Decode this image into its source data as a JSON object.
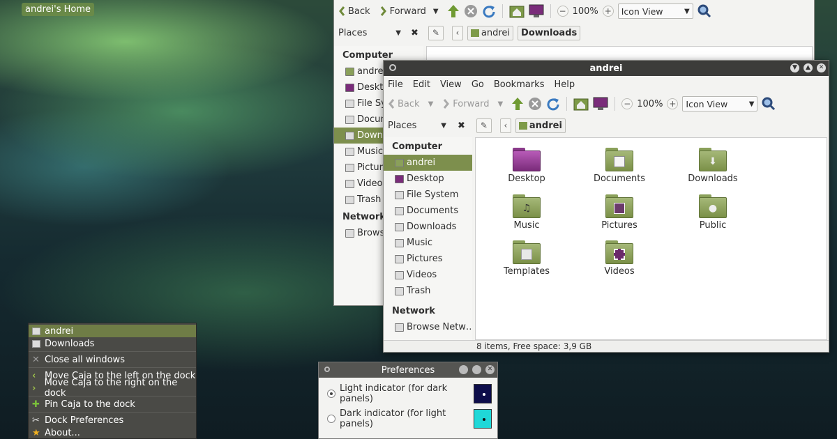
{
  "desktop": {
    "home_label": "andrei's Home"
  },
  "back_window": {
    "toolbar": {
      "back": "Back",
      "forward": "Forward",
      "zoom": "100%",
      "view_mode": "Icon View"
    },
    "location": {
      "places": "Places",
      "crumbs": [
        "andrei",
        "Downloads"
      ]
    },
    "sidebar": {
      "computer_heading": "Computer",
      "items": [
        "andrei",
        "Desktop",
        "File System",
        "Documents",
        "Downloads",
        "Music",
        "Pictures",
        "Videos",
        "Trash"
      ],
      "network_heading": "Network",
      "network_items": [
        "Browse Network"
      ]
    }
  },
  "front_window": {
    "title": "andrei",
    "menu": [
      "File",
      "Edit",
      "View",
      "Go",
      "Bookmarks",
      "Help"
    ],
    "toolbar": {
      "back": "Back",
      "forward": "Forward",
      "zoom": "100%",
      "view_mode": "Icon View"
    },
    "location": {
      "places": "Places",
      "crumbs": [
        "andrei"
      ]
    },
    "sidebar": {
      "computer_heading": "Computer",
      "items": [
        "andrei",
        "Desktop",
        "File System",
        "Documents",
        "Downloads",
        "Music",
        "Pictures",
        "Videos",
        "Trash"
      ],
      "network_heading": "Network",
      "network_items": [
        "Browse Netw…"
      ]
    },
    "files": [
      "Desktop",
      "Documents",
      "Downloads",
      "Music",
      "Pictures",
      "Public",
      "Templates",
      "Videos"
    ],
    "status": "8 items, Free space: 3,9 GB"
  },
  "dock_menu": {
    "items": [
      "andrei",
      "Downloads",
      "Close all windows",
      "Move Caja to the left on the dock",
      "Move Caja to the right on the dock",
      "Pin Caja to the dock",
      "Dock Preferences",
      "About..."
    ]
  },
  "preferences": {
    "title": "Preferences",
    "options": [
      {
        "label": "Light indicator (for dark panels)",
        "selected": true,
        "color": "#0d0d4a"
      },
      {
        "label": "Dark indicator (for light panels)",
        "selected": false,
        "color": "#1fd8d8"
      }
    ]
  },
  "colors": {
    "accent": "#7d8f4d",
    "titlebar": "#3c3c3a",
    "dock_bg": "#4a4a46"
  }
}
